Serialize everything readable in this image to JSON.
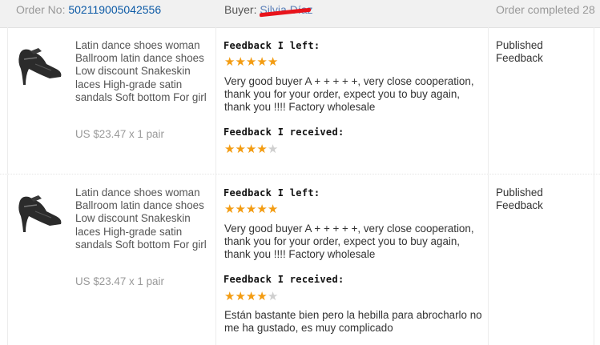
{
  "header": {
    "order_label": "Order No:",
    "order_number": "502119005042556",
    "buyer_label": "Buyer:",
    "buyer_name": "Silvia Díaz",
    "status": "Order completed 28"
  },
  "orders": [
    {
      "product_title": "Latin dance shoes woman Ballroom latin dance shoes Low discount Snakeskin laces High-grade satin sandals Soft bottom For girl",
      "price": "US $23.47 x 1 pair",
      "feedback_left_label": "Feedback I left:",
      "feedback_left_stars": 5,
      "feedback_left_text": "Very good buyer A + + + + +, very close cooperation, thank you for your order, expect you to buy again, thank you !!!! Factory wholesale",
      "feedback_received_label": "Feedback I received:",
      "feedback_received_stars": 4,
      "feedback_received_text": "",
      "status_text": "Published Feedback"
    },
    {
      "product_title": "Latin dance shoes woman Ballroom latin dance shoes Low discount Snakeskin laces High-grade satin sandals Soft bottom For girl",
      "price": "US $23.47 x 1 pair",
      "feedback_left_label": "Feedback I left:",
      "feedback_left_stars": 5,
      "feedback_left_text": "Very good buyer A + + + + +, very close cooperation, thank you for your order, expect you to buy again, thank you !!!! Factory wholesale",
      "feedback_received_label": "Feedback I received:",
      "feedback_received_stars": 4,
      "feedback_received_text": "Están bastante bien pero la hebilla para abrocharlo no me ha gustado, es muy complicado",
      "status_text": "Published Feedback"
    }
  ],
  "colors": {
    "star_on": "#f39c12",
    "star_off": "#cfcfcf",
    "link": "#0c5aa6"
  }
}
